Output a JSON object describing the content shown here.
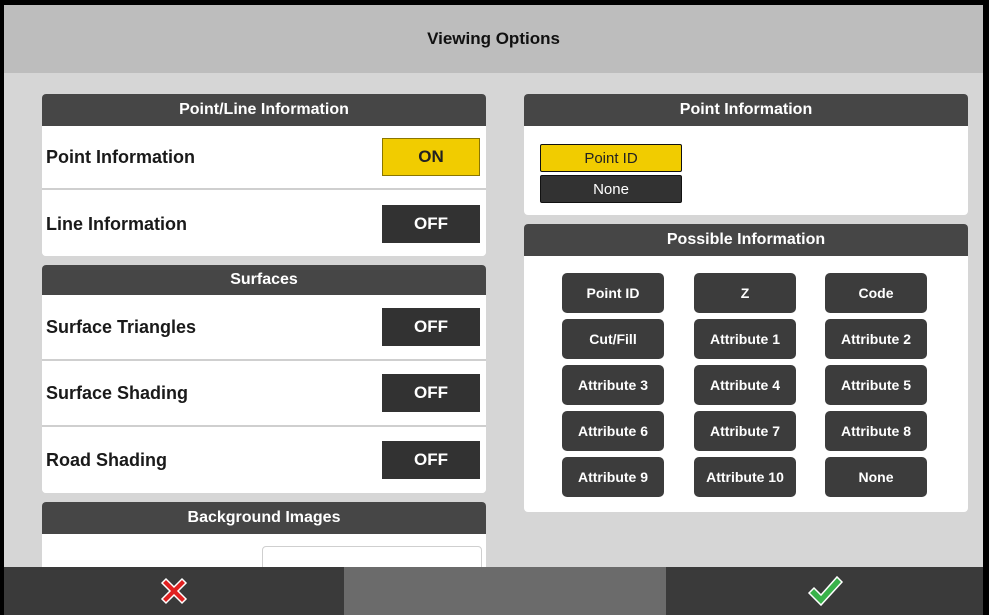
{
  "window": {
    "title": "Viewing Options"
  },
  "point_line": {
    "header": "Point/Line Information",
    "rows": [
      {
        "label": "Point Information",
        "state": "ON"
      },
      {
        "label": "Line Information",
        "state": "OFF"
      }
    ]
  },
  "surfaces": {
    "header": "Surfaces",
    "rows": [
      {
        "label": "Surface Triangles",
        "state": "OFF"
      },
      {
        "label": "Surface Shading",
        "state": "OFF"
      },
      {
        "label": "Road Shading",
        "state": "OFF"
      }
    ]
  },
  "background_images": {
    "header": "Background Images"
  },
  "point_information": {
    "header": "Point Information",
    "selected": [
      "Point ID",
      "None"
    ]
  },
  "possible_information": {
    "header": "Possible Information",
    "buttons": [
      "Point ID",
      "Z",
      "Code",
      "Cut/Fill",
      "Attribute 1",
      "Attribute 2",
      "Attribute 3",
      "Attribute 4",
      "Attribute 5",
      "Attribute 6",
      "Attribute 7",
      "Attribute 8",
      "Attribute 9",
      "Attribute 10",
      "None"
    ]
  },
  "footer": {
    "cancel_icon": "red-x-icon",
    "confirm_icon": "green-check-icon"
  },
  "colors": {
    "accent_on": "#f1cc00",
    "header_bg": "#464646",
    "cancel": "#e02020",
    "confirm": "#39b24a"
  }
}
